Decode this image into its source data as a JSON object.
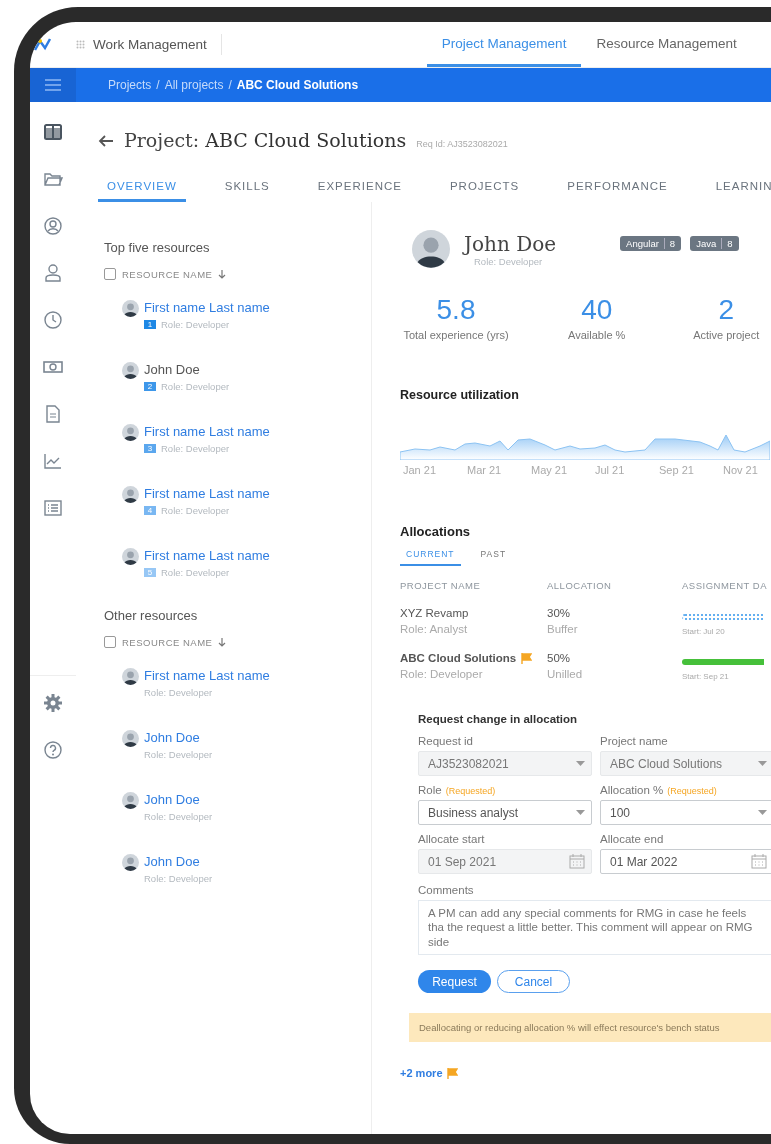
{
  "app_bar": {
    "title": "Work Management",
    "tabs": [
      {
        "label": "Project Management",
        "selected": true
      },
      {
        "label": "Resource Management",
        "selected": false
      }
    ]
  },
  "breadcrumb": {
    "separator": "/",
    "items": [
      {
        "label": "Projects",
        "selected": false
      },
      {
        "label": "All projects",
        "selected": false
      },
      {
        "label": "ABC Cloud Solutions",
        "selected": true
      }
    ]
  },
  "sidebar": {
    "items": [
      {
        "kind": "columns",
        "selected": true
      },
      {
        "kind": "folder",
        "selected": false
      },
      {
        "kind": "user-circle",
        "selected": false
      },
      {
        "kind": "user",
        "selected": false
      },
      {
        "kind": "clock",
        "selected": false
      },
      {
        "kind": "money",
        "selected": false
      },
      {
        "kind": "document",
        "selected": false
      },
      {
        "kind": "chart",
        "selected": false
      },
      {
        "kind": "list",
        "selected": false
      }
    ],
    "bottom_items": [
      {
        "kind": "settings",
        "selected": false
      },
      {
        "kind": "help",
        "selected": false
      }
    ]
  },
  "project": {
    "prefix": "Project:",
    "name": "ABC Cloud Solutions",
    "req_id": "Req Id: AJ3523082021"
  },
  "tabs": [
    {
      "label": "OVERVIEW",
      "selected": true
    },
    {
      "label": "SKILLS",
      "selected": false
    },
    {
      "label": "EXPERIENCE",
      "selected": false
    },
    {
      "label": "PROJECTS",
      "selected": false
    },
    {
      "label": "PERFORMANCE",
      "selected": false
    },
    {
      "label": "LEARNIN",
      "selected": false
    }
  ],
  "resource_groups": [
    {
      "title": "Top five resources",
      "column": "RESOURCE NAME",
      "checked": false,
      "items": [
        {
          "name": "First name Last name",
          "rank": "1",
          "color": "#1e88e5",
          "role": "Role: Developer",
          "selected": false
        },
        {
          "name": "John Doe",
          "rank": "2",
          "color": "#3d97ea",
          "role": "Role: Developer",
          "selected": true
        },
        {
          "name": "First name Last name",
          "rank": "3",
          "color": "#5ba7ee",
          "role": "Role: Developer",
          "selected": false
        },
        {
          "name": "First name Last name",
          "rank": "4",
          "color": "#79b7f2",
          "role": "Role: Developer",
          "selected": false
        },
        {
          "name": "First name Last name",
          "rank": "5",
          "color": "#97c7f5",
          "role": "Role: Developer",
          "selected": false
        }
      ]
    },
    {
      "title": "Other resources",
      "column": "RESOURCE NAME",
      "checked": false,
      "items": [
        {
          "name": "First name Last name",
          "role": "Role: Developer",
          "selected": false
        },
        {
          "name": "John Doe",
          "role": "Role: Developer",
          "selected": false
        },
        {
          "name": "John Doe",
          "role": "Role: Developer",
          "selected": false
        },
        {
          "name": "John Doe",
          "role": "Role: Developer",
          "selected": false
        }
      ]
    }
  ],
  "profile": {
    "name": "John Doe",
    "role": "Role: Developer",
    "skills": [
      {
        "name": "Angular",
        "score": "8"
      },
      {
        "name": "Java",
        "score": "8"
      }
    ],
    "stats": [
      {
        "value": "5.8",
        "label": "Total experience (yrs)"
      },
      {
        "value": "40",
        "label": "Available %"
      },
      {
        "value": "2",
        "label": "Active project"
      }
    ]
  },
  "utilization": {
    "title": "Resource utilization",
    "x_labels": [
      "Jan 21",
      "Mar 21",
      "May 21",
      "Jul 21",
      "Sep 21",
      "Nov 21"
    ]
  },
  "allocations": {
    "title": "Allocations",
    "tabs": [
      {
        "label": "CURRENT",
        "selected": true
      },
      {
        "label": "PAST",
        "selected": false
      }
    ],
    "columns": [
      "PROJECT NAME",
      "ALLOCATION",
      "ASSIGNMENT DA"
    ],
    "rows": [
      {
        "project": "XYZ Revamp",
        "flagged": false,
        "role": "Role: Analyst",
        "allocation": "30%",
        "type": "Buffer",
        "kind": "dotted",
        "start": "Start: Jul 20"
      },
      {
        "project": "ABC Cloud Solutions",
        "flagged": true,
        "role": "Role: Developer",
        "allocation": "50%",
        "type": "Unilled",
        "kind": "solid",
        "start": "Start: Sep 21"
      }
    ]
  },
  "request_form": {
    "title": "Request change in allocation",
    "fields": [
      {
        "label": "Request id",
        "value": "AJ3523082021",
        "kind": "select",
        "disabled": true
      },
      {
        "label": "Project name",
        "value": "ABC Cloud Solutions",
        "kind": "select",
        "disabled": true
      },
      {
        "label": "Role",
        "tag": "(Requested)",
        "value": "Business analyst",
        "kind": "select",
        "disabled": false
      },
      {
        "label": "Allocation %",
        "tag": "(Requested)",
        "value": "100",
        "kind": "select",
        "disabled": false
      },
      {
        "label": "Allocate start",
        "value": "01 Sep 2021",
        "kind": "date",
        "disabled": true
      },
      {
        "label": "Allocate end",
        "value": "01 Mar 2022",
        "kind": "date",
        "disabled": false
      }
    ],
    "comments": {
      "label": "Comments",
      "value": "A PM can add any special comments for RMG in case he feels tha the request a little better. This comment will appear on RMG side"
    },
    "buttons": [
      {
        "label": "Request",
        "kind": "primary"
      },
      {
        "label": "Cancel",
        "kind": "secondary"
      }
    ]
  },
  "warning": "Deallocating or reducing allocation % will effect resource's bench status",
  "more": {
    "label": "+2 more",
    "flagged": true
  }
}
